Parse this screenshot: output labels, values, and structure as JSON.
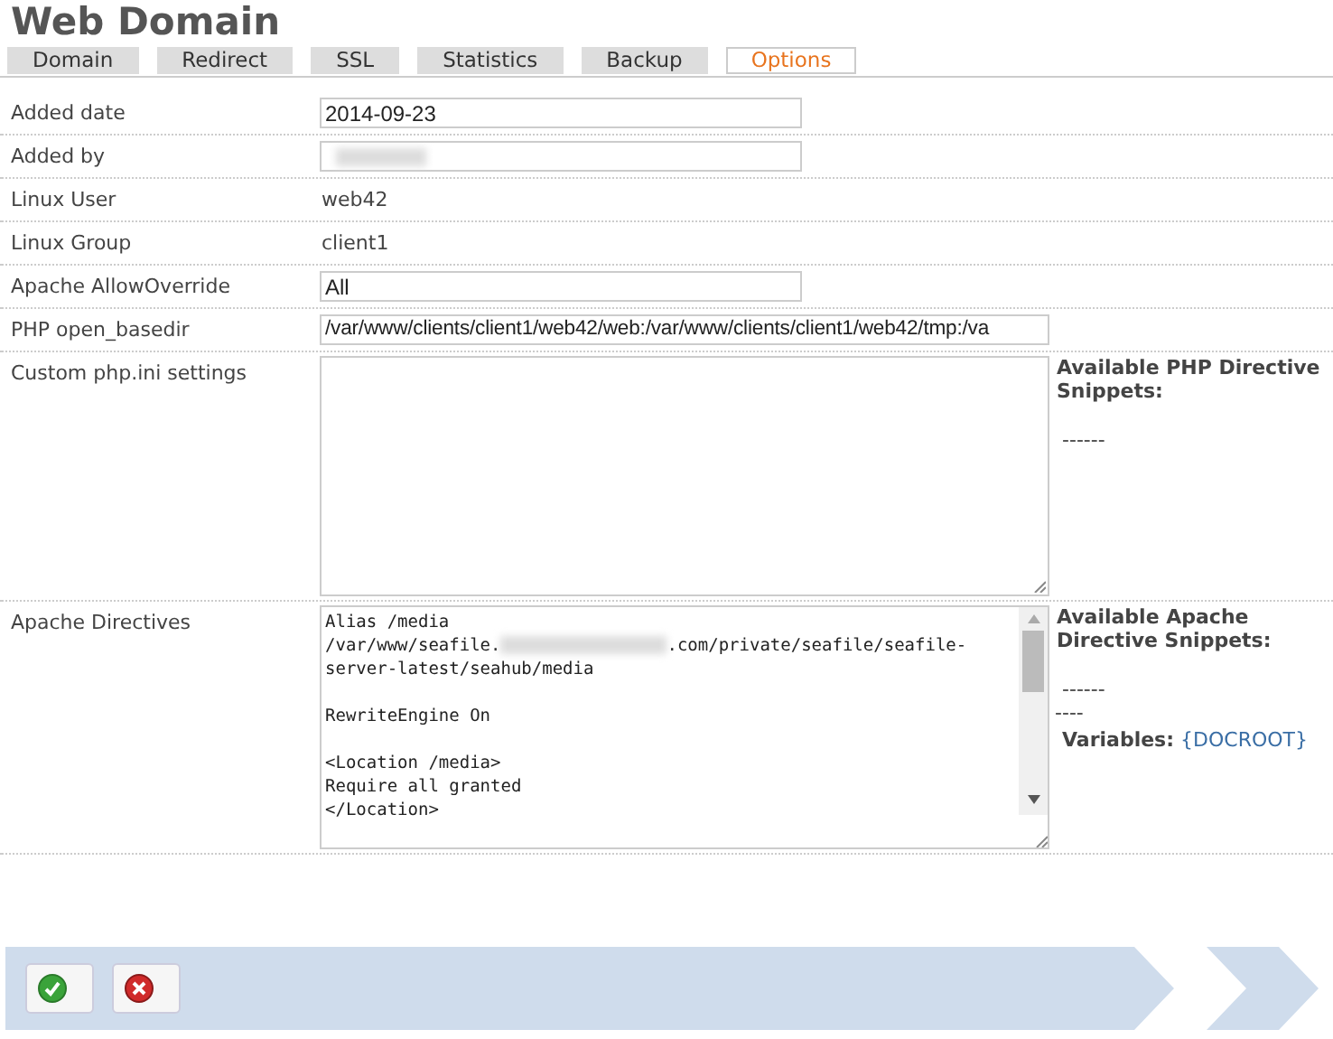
{
  "title": "Web Domain",
  "tabs": [
    {
      "label": "Domain",
      "selected": false
    },
    {
      "label": "Redirect",
      "selected": false
    },
    {
      "label": "SSL",
      "selected": false
    },
    {
      "label": "Statistics",
      "selected": false
    },
    {
      "label": "Backup",
      "selected": false
    },
    {
      "label": "Options",
      "selected": true
    }
  ],
  "fields": [
    {
      "kind": "input",
      "label": "Added date",
      "value": "2014-09-23"
    },
    {
      "kind": "redacted-input",
      "label": "Added by"
    },
    {
      "kind": "text",
      "label": "Linux User",
      "value": "web42"
    },
    {
      "kind": "text",
      "label": "Linux Group",
      "value": "client1"
    },
    {
      "kind": "input",
      "label": "Apache AllowOverride",
      "value": "All"
    },
    {
      "kind": "wide-input",
      "label": "PHP open_basedir",
      "value": "/var/www/clients/client1/web42/web:/var/www/clients/client1/web42/tmp:/va"
    },
    {
      "kind": "textarea",
      "label": "Custom php.ini settings",
      "side_title": "Available PHP Directive Snippets:",
      "side_lines": [
        "------"
      ]
    },
    {
      "kind": "code",
      "label": "Apache Directives",
      "lines": [
        {
          "kind": "text",
          "parts": [
            "Alias /media"
          ]
        },
        {
          "kind": "text",
          "parts": [
            "/var/www/seafile.",
            ".com/private/seafile/seafile-"
          ]
        },
        {
          "kind": "text",
          "parts": [
            "server-latest/seahub/media"
          ]
        },
        {
          "kind": "blank"
        },
        {
          "kind": "text",
          "parts": [
            "RewriteEngine On"
          ]
        },
        {
          "kind": "blank"
        },
        {
          "kind": "text",
          "parts": [
            "<Location /media>"
          ]
        },
        {
          "kind": "text",
          "parts": [
            "Require all granted"
          ]
        },
        {
          "kind": "text",
          "parts": [
            "</Location>"
          ]
        }
      ],
      "side_title": "Available Apache Directive Snippets:",
      "side_lines": [
        "------",
        "----"
      ],
      "variables_label": "Variables:",
      "variables_link": "{DOCROOT}"
    }
  ],
  "buttons": [
    {
      "kind": "save"
    },
    {
      "kind": "cancel"
    }
  ]
}
